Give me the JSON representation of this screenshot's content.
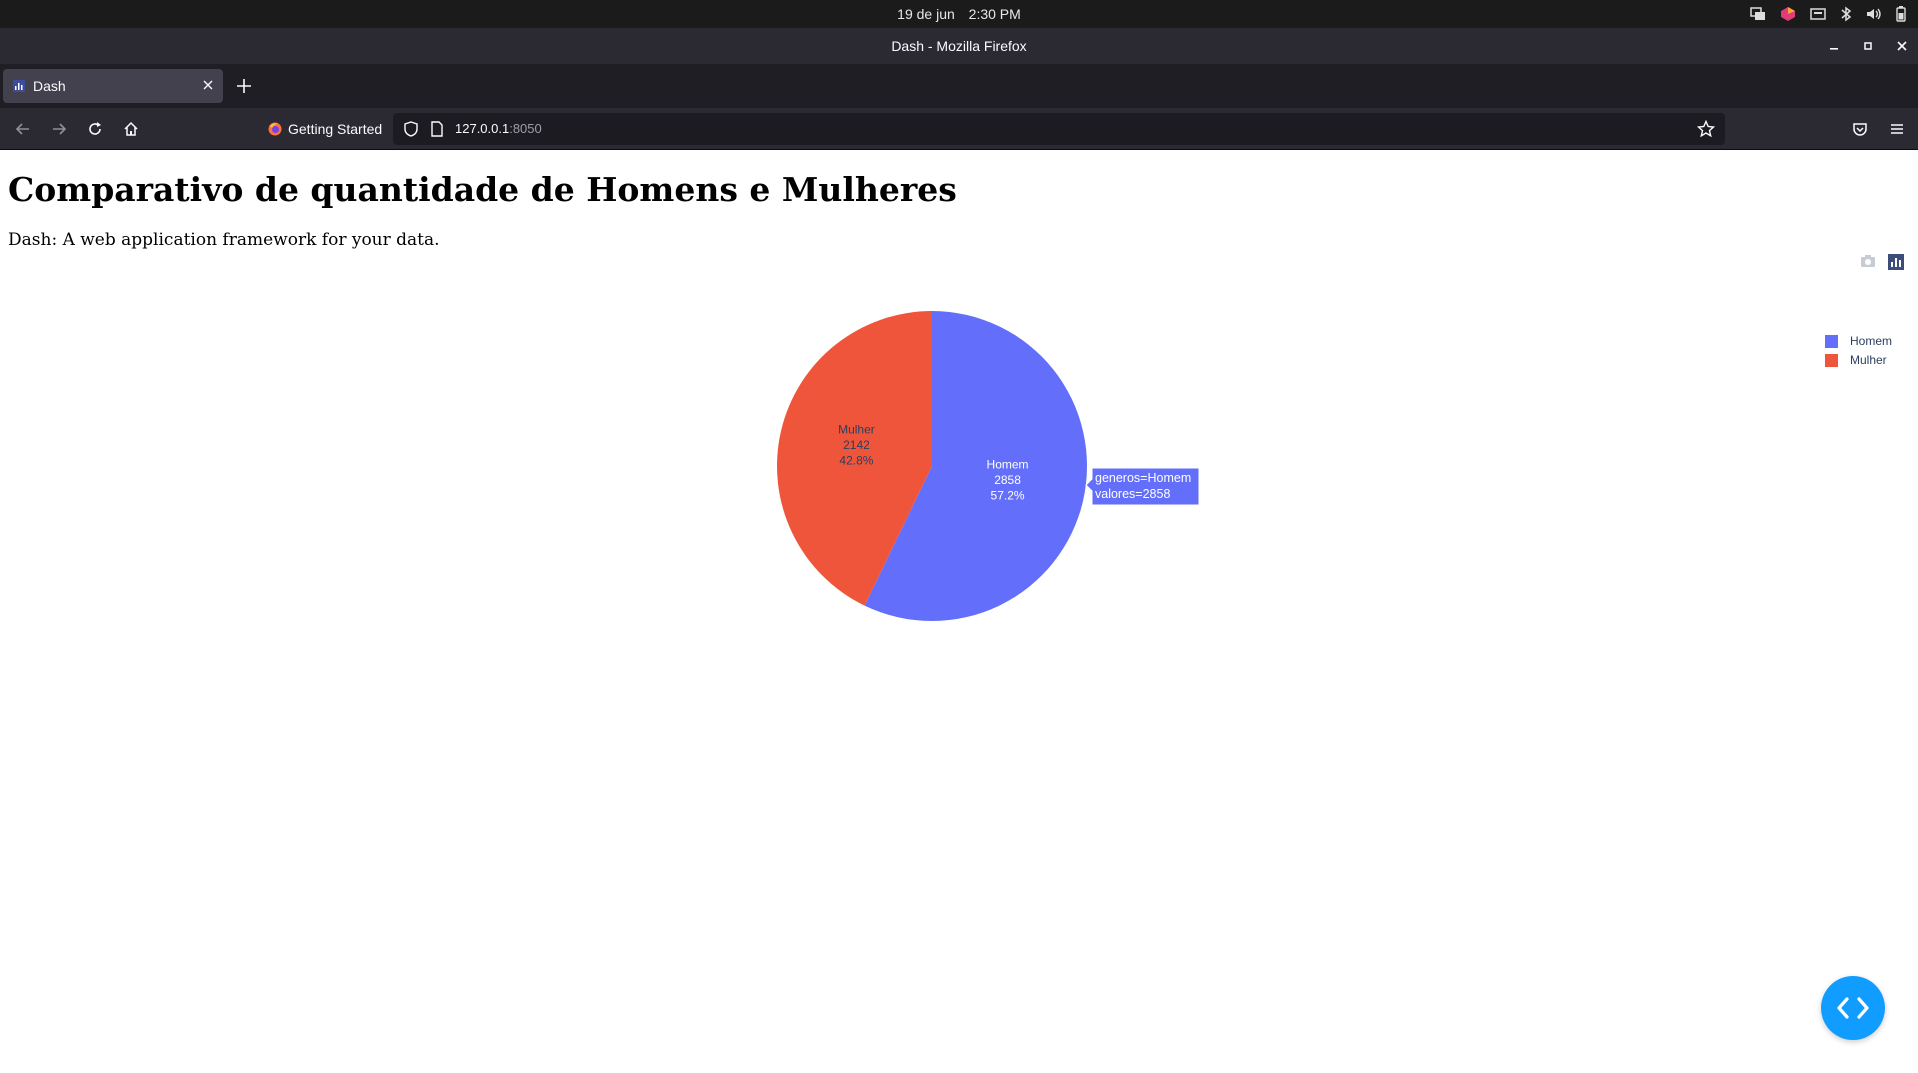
{
  "system_bar": {
    "date": "19 de jun",
    "time": "2:30 PM"
  },
  "window": {
    "title": "Dash - Mozilla Firefox"
  },
  "tabs": [
    {
      "label": "Dash",
      "active": true
    }
  ],
  "toolbar": {
    "bookmark_label": "Getting Started",
    "url_host": "127.0.0.1",
    "url_port": ":8050"
  },
  "page": {
    "heading": "Comparativo de quantidade de Homens e Mulheres",
    "description": "Dash: A web application framework for your data."
  },
  "chart_data": {
    "type": "pie",
    "labels": [
      "Homem",
      "Mulher"
    ],
    "values": [
      2858,
      2142
    ],
    "percents": [
      "57.2%",
      "42.8%"
    ],
    "colors": [
      "#636efa",
      "#ef553b"
    ],
    "legend": {
      "position": "top-right",
      "entries": [
        "Homem",
        "Mulher"
      ]
    },
    "hover_label": {
      "line1": "generos=Homem",
      "line2": "valores=2858"
    }
  },
  "colors": {
    "fab": "#119dff",
    "legend_text": "#2a3f5f",
    "browser_chrome": "#2b2a33"
  }
}
